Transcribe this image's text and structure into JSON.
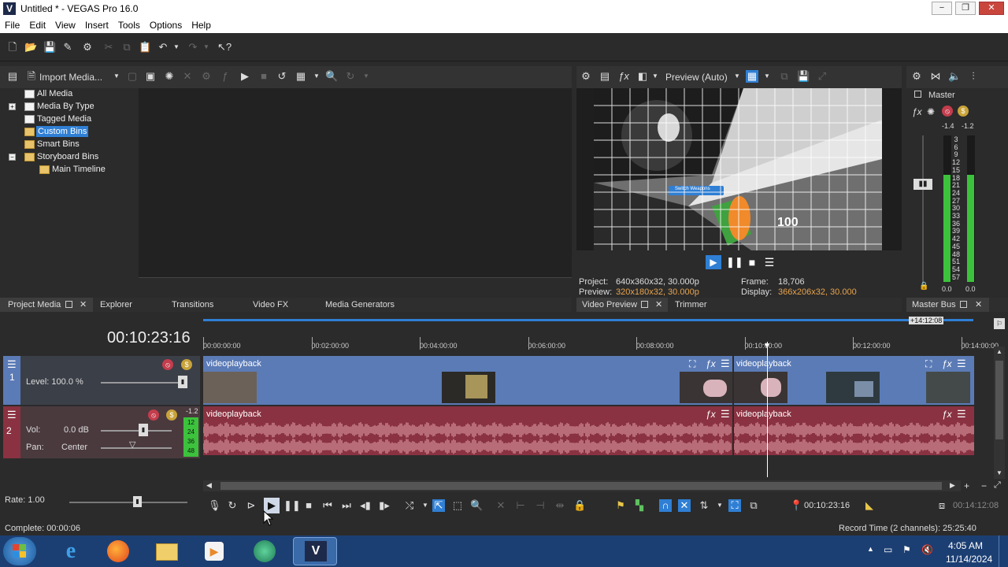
{
  "window": {
    "title": "Untitled * - VEGAS Pro 16.0",
    "logo_letter": "V",
    "minimize": "−",
    "maximize": "❐",
    "close": "✕"
  },
  "menu": [
    "File",
    "Edit",
    "View",
    "Insert",
    "Tools",
    "Options",
    "Help"
  ],
  "project_media": {
    "import_label": "Import Media...",
    "tree": [
      {
        "label": "All Media",
        "level": 0,
        "expander": "",
        "selected": false
      },
      {
        "label": "Media By Type",
        "level": 0,
        "expander": "+",
        "selected": false
      },
      {
        "label": "Tagged Media",
        "level": 0,
        "expander": "",
        "selected": false
      },
      {
        "label": "Custom Bins",
        "level": 0,
        "expander": "",
        "selected": true
      },
      {
        "label": "Smart Bins",
        "level": 0,
        "expander": "",
        "selected": false
      },
      {
        "label": "Storyboard Bins",
        "level": 0,
        "expander": "−",
        "selected": false
      },
      {
        "label": "Main Timeline",
        "level": 1,
        "expander": "",
        "selected": false
      }
    ],
    "tabs": [
      "Project Media",
      "Explorer",
      "Transitions",
      "Video FX",
      "Media Generators"
    ]
  },
  "preview": {
    "mode": "Preview (Auto)",
    "overlay_text": "Switch Weapons",
    "score_text": "100",
    "project_label": "Project:",
    "project_value": "640x360x32, 30.000p",
    "preview_label": "Preview:",
    "preview_value": "320x180x32, 30.000p",
    "frame_label": "Frame:",
    "frame_value": "18,706",
    "display_label": "Display:",
    "display_value": "366x206x32, 30.000",
    "tabs": [
      "Video Preview",
      "Trimmer"
    ]
  },
  "master": {
    "label": "Master",
    "peak_left": "-1.4",
    "peak_right": "-1.2",
    "scale": [
      "3",
      "6",
      "9",
      "12",
      "15",
      "18",
      "21",
      "24",
      "27",
      "30",
      "33",
      "36",
      "39",
      "42",
      "45",
      "48",
      "51",
      "54",
      "57"
    ],
    "zero_left": "0.0",
    "zero_right": "0.0",
    "tab": "Master Bus",
    "level_left": 0.73,
    "level_right": 0.73
  },
  "timeline": {
    "cursor_time": "00:10:23:16",
    "region_end": "+14:12:08",
    "ruler": [
      "00:00:00:00",
      "00:02:00:00",
      "00:04:00:00",
      "00:06:00:00",
      "00:08:00:00",
      "00:10:00:00",
      "00:12:00:00",
      "00:14:00:00"
    ],
    "track1": {
      "number": "1",
      "level_label": "Level: 100.0 %",
      "level_value": 1.0
    },
    "track2": {
      "number": "2",
      "vol_label": "Vol:",
      "vol_value": "0.0 dB",
      "pan_label": "Pan:",
      "pan_value": "Center",
      "peak": "-1.2",
      "meter_scale": [
        "12",
        "24",
        "36",
        "48"
      ]
    },
    "video_clips": [
      "videoplayback",
      "videoplayback"
    ],
    "audio_clips": [
      "videoplayback",
      "videoplayback"
    ],
    "rate_label": "Rate: 1.00",
    "transport_time": "00:10:23:16",
    "transport_end": "00:14:12:08"
  },
  "status": {
    "left": "Complete: 00:00:06",
    "right": "Record Time (2 channels): 25:25:40"
  },
  "taskbar": {
    "time": "4:05 AM",
    "date": "11/14/2024"
  },
  "colors": {
    "accent": "#2f7fd4",
    "video_track": "#5b7bb6",
    "audio_track": "#8a3241",
    "meter_green": "#3cc23c",
    "taskbar": "#1c3f73"
  }
}
